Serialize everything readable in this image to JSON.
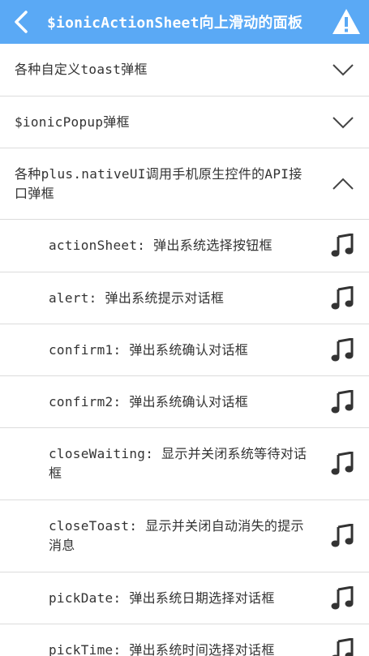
{
  "header": {
    "title": "$ionicActionSheet向上滑动的面板",
    "back_icon": "chevron-left-icon",
    "warn_icon": "warning-icon",
    "bg_color": "#5aa9f5"
  },
  "categories": [
    {
      "label": "各种自定义toast弹框",
      "icon": "chevron-down-icon"
    },
    {
      "label": "$ionicPopup弹框",
      "icon": "chevron-down-icon"
    },
    {
      "label": "各种plus.nativeUI调用手机原生控件的API接口弹框",
      "icon": "chevron-up-icon"
    }
  ],
  "items": [
    {
      "label": "actionSheet: 弹出系统选择按钮框",
      "icon": "music-note-icon"
    },
    {
      "label": "alert: 弹出系统提示对话框",
      "icon": "music-note-icon"
    },
    {
      "label": "confirm1: 弹出系统确认对话框",
      "icon": "music-note-icon"
    },
    {
      "label": "confirm2: 弹出系统确认对话框",
      "icon": "music-note-icon"
    },
    {
      "label": "closeWaiting: 显示并关闭系统等待对话框",
      "icon": "music-note-icon"
    },
    {
      "label": "closeToast: 显示并关闭自动消失的提示消息",
      "icon": "music-note-icon"
    },
    {
      "label": "pickDate: 弹出系统日期选择对话框",
      "icon": "music-note-icon"
    },
    {
      "label": "pickTime: 弹出系统时间选择对话框",
      "icon": "music-note-icon"
    }
  ]
}
